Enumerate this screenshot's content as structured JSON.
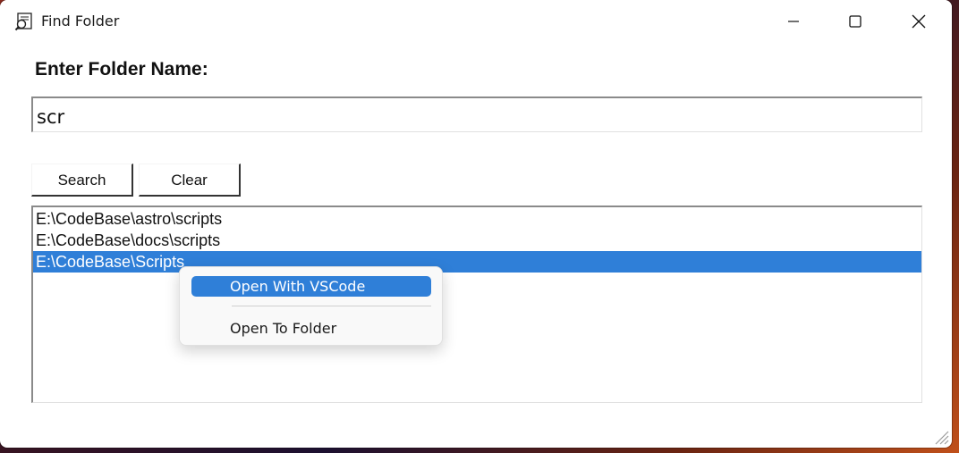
{
  "window": {
    "title": "Find Folder",
    "minimize_icon": "minimize-icon",
    "maximize_icon": "maximize-icon",
    "close_icon": "close-icon",
    "app_icon": "folder-search-icon"
  },
  "form": {
    "heading": "Enter Folder Name:",
    "input_value": "scr",
    "search_label": "Search",
    "clear_label": "Clear"
  },
  "results": {
    "items": [
      "E:\\CodeBase\\astro\\scripts",
      "E:\\CodeBase\\docs\\scripts",
      "E:\\CodeBase\\Scripts"
    ],
    "selected_index": 2
  },
  "context_menu": {
    "items": [
      "Open With VSCode",
      "Open To Folder"
    ],
    "highlighted_index": 0
  },
  "colors": {
    "selection": "#2f7fd8",
    "window_bg": "#ffffff"
  }
}
